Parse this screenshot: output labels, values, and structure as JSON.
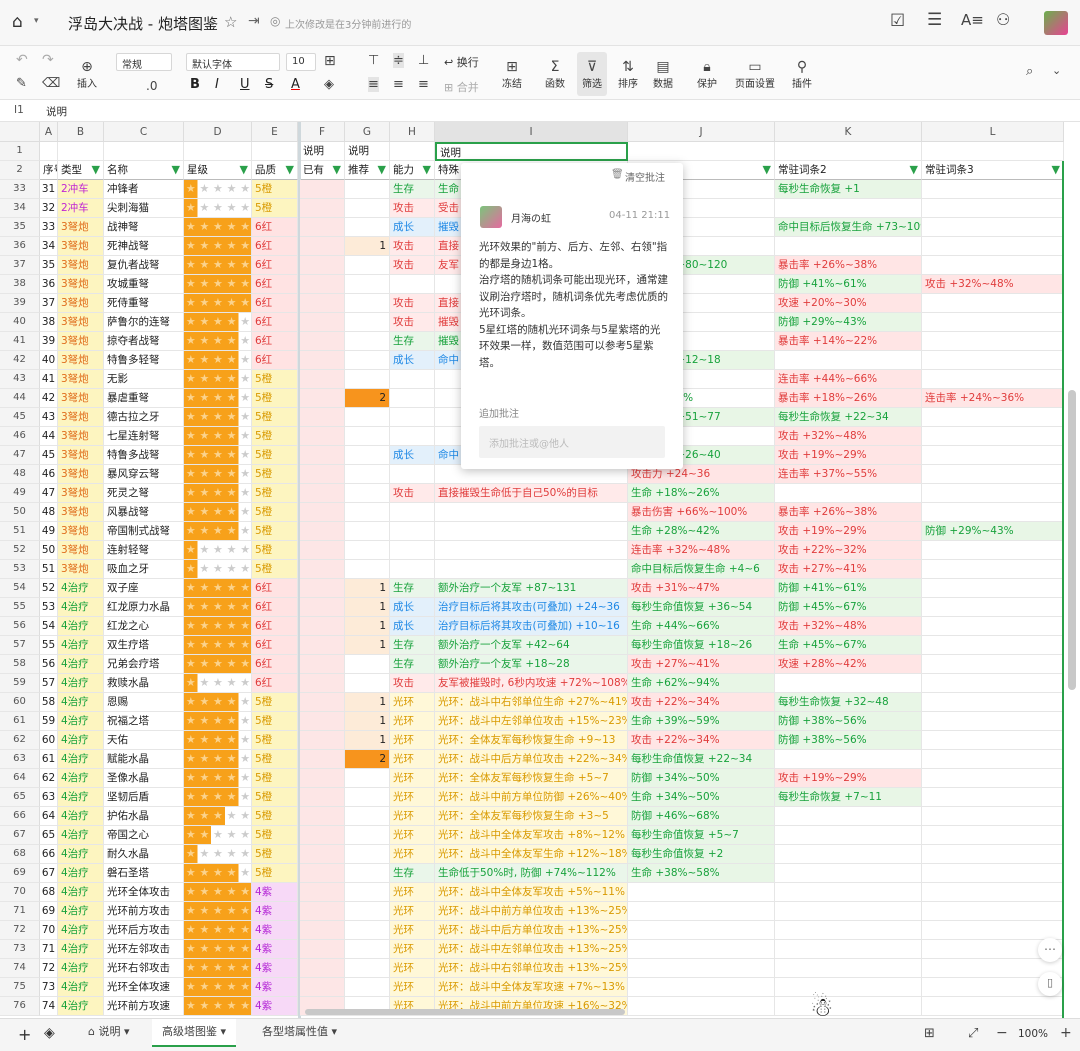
{
  "doc": {
    "title": "浮岛大决战 - 炮塔图鉴",
    "save_status": "上次修改是在3分钟前进行的"
  },
  "toolbar": {
    "font_style": "常规",
    "font_name": "默认字体",
    "font_size": "10",
    "decimal": ".0",
    "items": [
      "插入",
      "换行",
      "合并",
      "冻结",
      "函数",
      "筛选",
      "排序",
      "数据",
      "保护",
      "页面设置",
      "插件"
    ]
  },
  "formula": {
    "cell_ref": "I1",
    "content": "说明"
  },
  "columns": [
    "A",
    "B",
    "C",
    "D",
    "E",
    "F",
    "G",
    "H",
    "I",
    "J",
    "K",
    "L"
  ],
  "row1": {
    "F": "说明",
    "G": "说明",
    "I": "说明"
  },
  "row2": {
    "A": "序号",
    "B": "类型",
    "C": "名称",
    "D": "星级",
    "E": "品质",
    "F": "已有",
    "G": "推荐",
    "H": "能力",
    "I": "特殊",
    "J": "",
    "K": "常驻词条2",
    "L": "常驻词条3"
  },
  "colors": {
    "type_cyan": "#b425d6",
    "type_orange": "#e06c1b",
    "type_green": "#18a23c",
    "orange_star": "#f7a11a",
    "red": "#e03c3c",
    "gold": "#d99a00"
  },
  "rows": [
    [
      "33",
      "31",
      "2冲车",
      "冲锋者",
      1,
      "5橙",
      "",
      "",
      "生存",
      "生命",
      "~34%",
      "每秒生命恢复 +1",
      ""
    ],
    [
      "34",
      "32",
      "2冲车",
      "尖刺海猫",
      1,
      "5橙",
      "",
      "",
      "攻击",
      "受击",
      "~17%",
      "",
      ""
    ],
    [
      "35",
      "33",
      "3弩炮",
      "战神弩",
      5,
      "6红",
      "",
      "",
      "成长",
      "摧毁",
      "%~59%",
      "命中目标后恢复生命 +73~109",
      ""
    ],
    [
      "36",
      "34",
      "3弩炮",
      "死神战弩",
      5,
      "6红",
      "",
      "1",
      "攻击",
      "直接",
      "~78%",
      "",
      ""
    ],
    [
      "37",
      "35",
      "3弩炮",
      "复仇者战弩",
      5,
      "6红",
      "",
      "",
      "攻击",
      "友军",
      "恢复生命 +80~120",
      "暴击率 +26%~38%",
      ""
    ],
    [
      "38",
      "36",
      "3弩炮",
      "攻城重弩",
      5,
      "6红",
      "",
      "",
      "",
      "",
      "~67%",
      "防御 +41%~61%",
      "攻击 +32%~48%"
    ],
    [
      "39",
      "37",
      "3弩炮",
      "死侍重弩",
      5,
      "6红",
      "",
      "",
      "攻击",
      "直接",
      "~38%",
      "攻速 +20%~30%",
      ""
    ],
    [
      "40",
      "38",
      "3弩炮",
      "萨鲁尔的连弩",
      4,
      "6红",
      "",
      "",
      "攻击",
      "摧毁",
      "~26%",
      "防御 +29%~43%",
      ""
    ],
    [
      "41",
      "39",
      "3弩炮",
      "掠夺者战弩",
      4,
      "6红",
      "",
      "",
      "生存",
      "摧毁",
      "~32%",
      "暴击率 +14%~22%",
      ""
    ],
    [
      "42",
      "40",
      "3弩炮",
      "特鲁多轻弩",
      4,
      "6红",
      "",
      "",
      "成长",
      "命中",
      "恢复生命 +12~18",
      "",
      ""
    ],
    [
      "43",
      "41",
      "3弩炮",
      "无影",
      4,
      "5橙",
      "",
      "",
      "",
      "",
      "~77%",
      "连击率 +44%~66%",
      ""
    ],
    [
      "44",
      "42",
      "3弩炮",
      "暴虐重弩",
      4,
      "5橙",
      "",
      "2",
      "",
      "",
      "89%~133%",
      "暴击率 +18%~26%",
      "连击率 +24%~36%"
    ],
    [
      "45",
      "43",
      "3弩炮",
      "德古拉之牙",
      4,
      "5橙",
      "",
      "",
      "",
      "",
      "恢复生命 +51~77",
      "每秒生命恢复 +22~34",
      ""
    ],
    [
      "46",
      "44",
      "3弩炮",
      "七星连射弩",
      4,
      "5橙",
      "",
      "",
      "",
      "",
      "~70%",
      "攻击 +32%~48%",
      ""
    ],
    [
      "47",
      "45",
      "3弩炮",
      "特鲁多战弩",
      4,
      "5橙",
      "",
      "",
      "成长",
      "命中",
      "恢复生命 +26~40",
      "攻击 +19%~29%",
      ""
    ],
    [
      "48",
      "46",
      "3弩炮",
      "暴风穿云弩",
      4,
      "5橙",
      "",
      "",
      "",
      "",
      "攻击力 +24~36",
      "连击率 +37%~55%",
      ""
    ],
    [
      "49",
      "47",
      "3弩炮",
      "死灵之弩",
      4,
      "5橙",
      "",
      "",
      "攻击",
      "直接摧毁生命低于自己50%的目标",
      "生命 +18%~26%",
      "",
      ""
    ],
    [
      "50",
      "48",
      "3弩炮",
      "风暴战弩",
      4,
      "5橙",
      "",
      "",
      "",
      "",
      "暴击伤害 +66%~100%",
      "暴击率 +26%~38%",
      ""
    ],
    [
      "51",
      "49",
      "3弩炮",
      "帝国制式战弩",
      4,
      "5橙",
      "",
      "",
      "",
      "",
      "生命 +28%~42%",
      "攻击 +19%~29%",
      "防御 +29%~43%"
    ],
    [
      "52",
      "50",
      "3弩炮",
      "连射轻弩",
      1,
      "5橙",
      "",
      "",
      "",
      "",
      "连击率 +32%~48%",
      "攻击 +22%~32%",
      ""
    ],
    [
      "53",
      "51",
      "3弩炮",
      "吸血之牙",
      1,
      "5橙",
      "",
      "",
      "",
      "",
      "命中目标后恢复生命 +4~6",
      "攻击 +27%~41%",
      ""
    ],
    [
      "54",
      "52",
      "4治疗",
      "双子座",
      5,
      "6红",
      "",
      "1",
      "生存",
      "额外治疗一个友军 +87~131",
      "攻击 +31%~47%",
      "防御 +41%~61%",
      ""
    ],
    [
      "55",
      "53",
      "4治疗",
      "红龙原力水晶",
      5,
      "6红",
      "",
      "1",
      "成长",
      "治疗目标后将其攻击(可叠加) +24~36",
      "每秒生命值恢复 +36~54",
      "防御 +45%~67%",
      ""
    ],
    [
      "56",
      "54",
      "4治疗",
      "红龙之心",
      5,
      "6红",
      "",
      "1",
      "成长",
      "治疗目标后将其攻击(可叠加) +10~16",
      "生命 +44%~66%",
      "攻击 +32%~48%",
      ""
    ],
    [
      "57",
      "55",
      "4治疗",
      "双生疗塔",
      5,
      "6红",
      "",
      "1",
      "生存",
      "额外治疗一个友军 +42~64",
      "每秒生命值恢复 +18~26",
      "生命 +45%~67%",
      ""
    ],
    [
      "58",
      "56",
      "4治疗",
      "兄弟会疗塔",
      5,
      "6红",
      "",
      "",
      "生存",
      "额外治疗一个友军 +18~28",
      "攻击 +27%~41%",
      "攻速 +28%~42%",
      ""
    ],
    [
      "59",
      "57",
      "4治疗",
      "救赎水晶",
      1,
      "6红",
      "",
      "",
      "攻击",
      "友军被摧毁时, 6秒内攻速 +72%~108%",
      "生命 +62%~94%",
      "",
      ""
    ],
    [
      "60",
      "58",
      "4治疗",
      "恩赐",
      4,
      "5橙",
      "",
      "1",
      "光环",
      "光环：战斗中右邻单位生命 +27%~41%",
      "攻击 +22%~34%",
      "每秒生命恢复 +32~48",
      ""
    ],
    [
      "61",
      "59",
      "4治疗",
      "祝福之塔",
      4,
      "5橙",
      "",
      "1",
      "光环",
      "光环：战斗中左邻单位攻击 +15%~23%",
      "生命 +39%~59%",
      "防御 +38%~56%",
      ""
    ],
    [
      "62",
      "60",
      "4治疗",
      "天佑",
      4,
      "5橙",
      "",
      "1",
      "光环",
      "光环：全体友军每秒恢复生命 +9~13",
      "攻击 +22%~34%",
      "防御 +38%~56%",
      ""
    ],
    [
      "63",
      "61",
      "4治疗",
      "赋能水晶",
      4,
      "5橙",
      "",
      "2",
      "光环",
      "光环：战斗中后方单位攻击 +22%~34%",
      "每秒生命值恢复 +22~34",
      "",
      ""
    ],
    [
      "64",
      "62",
      "4治疗",
      "圣像水晶",
      4,
      "5橙",
      "",
      "",
      "光环",
      "光环：全体友军每秒恢复生命 +5~7",
      "防御 +34%~50%",
      "攻击 +19%~29%",
      ""
    ],
    [
      "65",
      "63",
      "4治疗",
      "坚韧后盾",
      4,
      "5橙",
      "",
      "",
      "光环",
      "光环：战斗中前方单位防御 +26%~40%",
      "生命 +34%~50%",
      "每秒生命恢复 +7~11",
      ""
    ],
    [
      "66",
      "64",
      "4治疗",
      "护佑水晶",
      3,
      "5橙",
      "",
      "",
      "光环",
      "光环：全体友军每秒恢复生命 +3~5",
      "防御 +46%~68%",
      "",
      ""
    ],
    [
      "67",
      "65",
      "4治疗",
      "帝国之心",
      2,
      "5橙",
      "",
      "",
      "光环",
      "光环：战斗中全体友军攻击 +8%~12%",
      "每秒生命值恢复 +5~7",
      "",
      ""
    ],
    [
      "68",
      "66",
      "4治疗",
      "耐久水晶",
      1,
      "5橙",
      "",
      "",
      "光环",
      "光环：战斗中全体友军生命 +12%~18%",
      "每秒生命值恢复 +2",
      "",
      ""
    ],
    [
      "69",
      "67",
      "4治疗",
      "磐石圣塔",
      4,
      "5橙",
      "",
      "",
      "生存",
      "生命低于50%时, 防御 +74%~112%",
      "生命 +38%~58%",
      "",
      ""
    ],
    [
      "70",
      "68",
      "4治疗",
      "光环全体攻击",
      5,
      "4紫",
      "",
      "",
      "光环",
      "光环：战斗中全体友军攻击 +5%~11%",
      "",
      "",
      ""
    ],
    [
      "71",
      "69",
      "4治疗",
      "光环前方攻击",
      5,
      "4紫",
      "",
      "",
      "光环",
      "光环：战斗中前方单位攻击 +13%~25%",
      "",
      "",
      ""
    ],
    [
      "72",
      "70",
      "4治疗",
      "光环后方攻击",
      5,
      "4紫",
      "",
      "",
      "光环",
      "光环：战斗中后方单位攻击 +13%~25%",
      "",
      "",
      ""
    ],
    [
      "73",
      "71",
      "4治疗",
      "光环左邻攻击",
      5,
      "4紫",
      "",
      "",
      "光环",
      "光环：战斗中左邻单位攻击 +13%~25%",
      "",
      "",
      ""
    ],
    [
      "74",
      "72",
      "4治疗",
      "光环右邻攻击",
      5,
      "4紫",
      "",
      "",
      "光环",
      "光环：战斗中右邻单位攻击 +13%~25%",
      "",
      "",
      ""
    ],
    [
      "75",
      "73",
      "4治疗",
      "光环全体攻速",
      5,
      "4紫",
      "",
      "",
      "光环",
      "光环：战斗中全体友军攻速 +7%~13%",
      "",
      "",
      ""
    ],
    [
      "76",
      "74",
      "4治疗",
      "光环前方攻速",
      5,
      "4紫",
      "",
      "",
      "光环",
      "光环：战斗中前方单位攻速 +16%~32%",
      "",
      "",
      ""
    ]
  ],
  "comment": {
    "clear": "清空批注",
    "author": "月海の虹",
    "time": "04-11 21:11",
    "text": "光环效果的\"前方、后方、左邻、右领\"指的都是身边1格。\n治疗塔的随机词条可能出现光环，通常建议刷治疗塔时，随机词条优先考虑优质的光环词条。\n5星红塔的随机光环词条与5星紫塔的光环效果一样，数值范围可以参考5星紫塔。",
    "add_label": "追加批注",
    "add_placeholder": "添加批注或@他人"
  },
  "tabs": [
    {
      "label": "说明"
    },
    {
      "label": "高级塔图鉴"
    },
    {
      "label": "各型塔属性值"
    }
  ],
  "zoom": "100%"
}
